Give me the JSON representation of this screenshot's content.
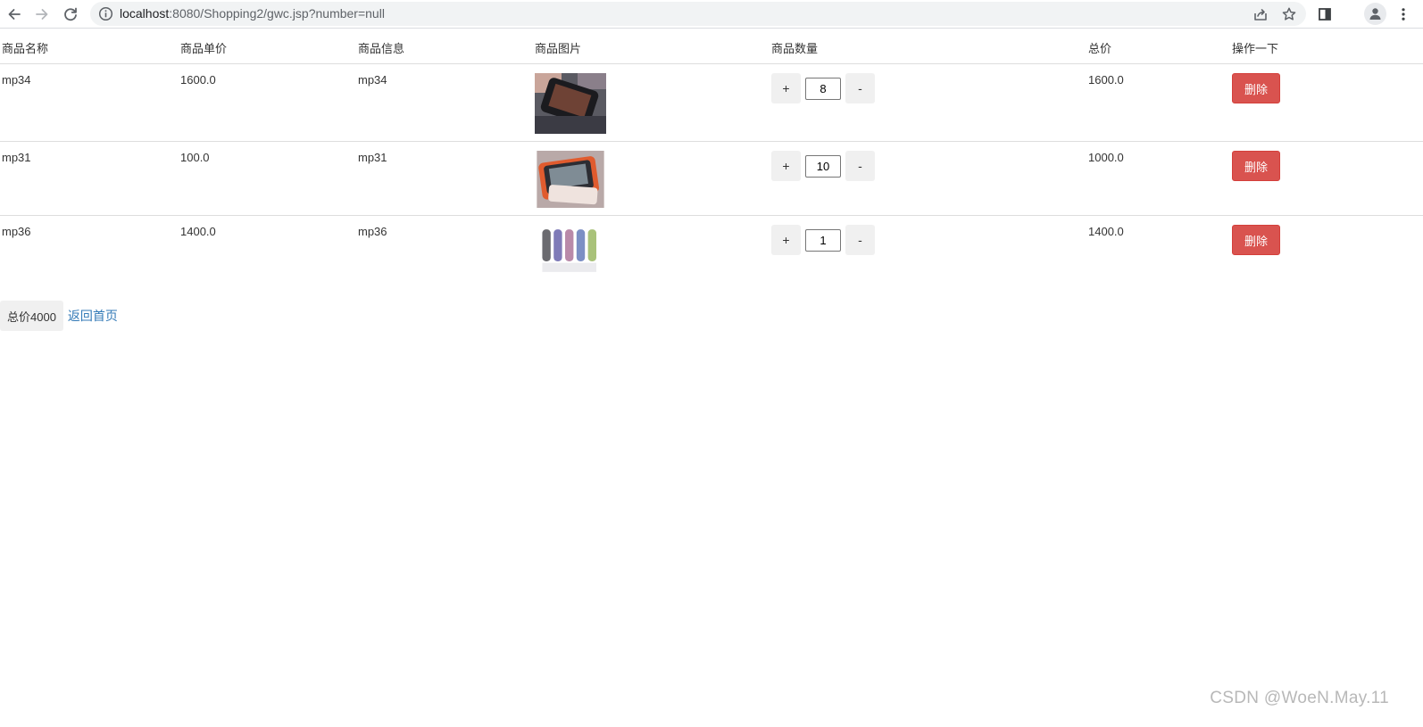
{
  "browser": {
    "url_host": "localhost",
    "url_rest": ":8080/Shopping2/gwc.jsp?number=null"
  },
  "table": {
    "headers": [
      "商品名称",
      "商品单价",
      "商品信息",
      "商品图片",
      "商品数量",
      "总价",
      "操作一下"
    ],
    "rows": [
      {
        "name": "mp34",
        "unit_price": "1600.0",
        "info": "mp34",
        "image": "mp3-player-photo",
        "quantity": "8",
        "total": "1600.0",
        "plus_label": "+",
        "minus_label": "-",
        "delete_label": "删除"
      },
      {
        "name": "mp31",
        "unit_price": "100.0",
        "info": "mp31",
        "image": "mp3-player-photo",
        "quantity": "10",
        "total": "1000.0",
        "plus_label": "+",
        "minus_label": "-",
        "delete_label": "删除"
      },
      {
        "name": "mp36",
        "unit_price": "1400.0",
        "info": "mp36",
        "image": "mp3-players-colors-photo",
        "quantity": "1",
        "total": "1400.0",
        "plus_label": "+",
        "minus_label": "-",
        "delete_label": "删除"
      }
    ]
  },
  "footer": {
    "total_label": "总价4000",
    "home_link": "返回首页"
  },
  "watermark": "CSDN @WoeN.May.11",
  "colors": {
    "delete": "#d9534f",
    "link": "#337ab7",
    "button_bg": "#f0f0f0"
  }
}
